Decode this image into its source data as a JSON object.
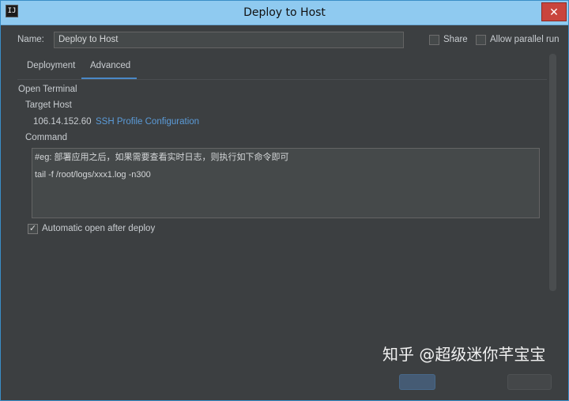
{
  "window": {
    "title": "Deploy to Host",
    "icon_text": "IJ"
  },
  "name_field": {
    "label": "Name:",
    "value": "Deploy to Host"
  },
  "options": {
    "share_label": "Share",
    "parallel_label": "Allow parallel run"
  },
  "tabs": [
    {
      "label": "Deployment",
      "active": false
    },
    {
      "label": "Advanced",
      "active": true
    }
  ],
  "open_terminal": {
    "section_label": "Open Terminal",
    "target_host_label": "Target Host",
    "host_ip": "106.14.152.60",
    "ssh_link": "SSH Profile Configuration",
    "command_label": "Command",
    "command_lines": [
      "#eg: 部署应用之后，如果需要查看实时日志，则执行如下命令即可",
      "tail -f /root/logs/xxx1.log -n300"
    ],
    "auto_open_label": "Automatic open after deploy",
    "auto_open_checked": true
  },
  "watermark": "知乎 @超级迷你芊宝宝",
  "colors": {
    "titlebar": "#8fcaf0",
    "accent": "#4a88c7",
    "link": "#5b9bd8",
    "close": "#c9453d"
  },
  "icons": [
    "app-icon",
    "close-icon",
    "checkmark-icon"
  ]
}
